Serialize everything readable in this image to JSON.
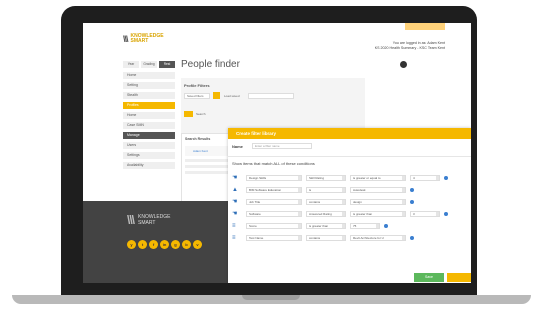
{
  "header": {
    "logo_line1": "KNOWLEDGE",
    "logo_line2": "SMART",
    "user_line1": "You are logged in as: Adam Kent",
    "user_line2": "KS 2020 Health Summary - KSC Team Kent"
  },
  "page": {
    "title": "People finder"
  },
  "sidebar": {
    "tabs": [
      "Year",
      "Grading",
      "Rest"
    ],
    "items": [
      {
        "label": "Home"
      },
      {
        "label": "Setting"
      },
      {
        "label": "Stealth"
      },
      {
        "label": "Profiles"
      },
      {
        "label": "Home"
      },
      {
        "label": "Case SMN"
      },
      {
        "label": "Manage"
      },
      {
        "label": "Users"
      },
      {
        "label": "Settings"
      },
      {
        "label": "Availability"
      }
    ]
  },
  "panel": {
    "label": "Profile Filters",
    "select_value": "Saved filters",
    "name_label": "Load saved",
    "button_label": "Search"
  },
  "search_box": {
    "title": "Search Results",
    "item": "Adam Kent"
  },
  "promo": {
    "line1": "KNOWLEDGE",
    "line2": "SMART",
    "social": [
      "y",
      "t",
      "f",
      "in",
      "g",
      "b",
      "v"
    ]
  },
  "modal": {
    "title": "Create filter library",
    "name_label": "Name",
    "name_placeholder": "Enter a filter name",
    "conditions_title": "Show items that match ALL of these conditions",
    "conditions": [
      {
        "icon": "☚",
        "field": "Design Skills",
        "op": "Skill Rating",
        "cmp": "is greater or equal to",
        "val": "4"
      },
      {
        "icon": "▲",
        "field": "BIM Software Education",
        "op": "is",
        "cmp": "Autodesk",
        "val": ""
      },
      {
        "icon": "☚",
        "field": "Job Title",
        "op": "contains",
        "cmp": "design",
        "val": ""
      },
      {
        "icon": "☚",
        "field": "Software",
        "op": "Answered Rating",
        "cmp": "is greater than",
        "val": "3"
      },
      {
        "icon": "≡",
        "field": "Score",
        "op": "is greater than",
        "cmp": "75",
        "val": ""
      },
      {
        "icon": "≡",
        "field": "Test Name",
        "op": "contains",
        "cmp": "Revit Architecture for U",
        "val": ""
      }
    ],
    "save_label": "Save"
  }
}
